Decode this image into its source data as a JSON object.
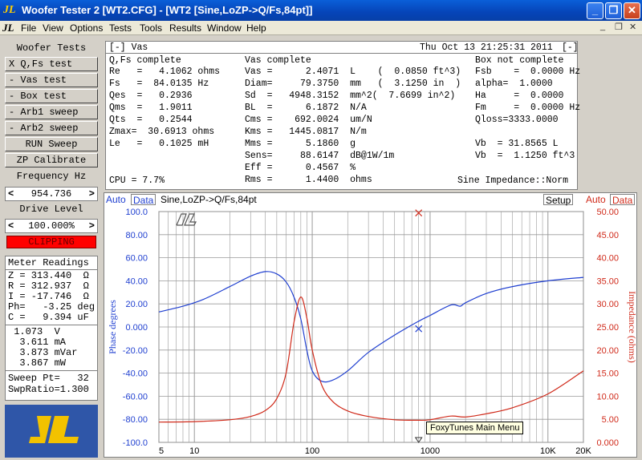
{
  "window": {
    "title": "Woofer Tester 2 [WT2.CFG] - [WT2 [Sine,LoZP->Q/Fs,84pt]]",
    "logo": "JL"
  },
  "menu": [
    "File",
    "View",
    "Options",
    "Tests",
    "Tools",
    "Results",
    "Window",
    "Help"
  ],
  "left": {
    "header": "Woofer Tests",
    "buttons": [
      "X Q,Fs test",
      "- Vas test",
      "- Box test",
      "- Arb1 sweep",
      "- Arb2 sweep",
      "RUN Sweep",
      "ZP Calibrate"
    ],
    "freq_label": "Frequency Hz",
    "freq_value": "954.736",
    "drive_label": "Drive Level",
    "drive_value": "100.000%",
    "clipping": "CLIPPING",
    "meter_title": "Meter Readings",
    "meter": [
      "Z = 313.440  Ω",
      "R = 312.937  Ω",
      "I = -17.746  Ω",
      "Ph=   -3.25 deg",
      "C =   9.394 uF"
    ],
    "meter2": [
      " 1.073  V",
      "  3.611 mA",
      "  3.873 mVar",
      "  3.867 mW"
    ],
    "meter3": [
      "Sweep Pt=   32",
      "SwpRatio=1.300"
    ]
  },
  "vas": {
    "title": "[-] Vas",
    "datetime": "Thu Oct 13 21:25:31 2011",
    "close": "[-]",
    "col1_head": "Q,Fs complete",
    "col2_head": "Vas complete",
    "col3_head": "Box not complete",
    "col1": [
      "Re   =   4.1062 ohms",
      "Fs   =  84.0135 Hz",
      "Qes  =   0.2936",
      "Qms  =   1.9011",
      "Qts  =   0.2544",
      "Zmax=  30.6913 ohms",
      "Le   =   0.1025 mH"
    ],
    "col2": [
      "Vas =      2.4071  L    (  0.0850 ft^3)",
      "Diam=     79.3750  mm   (  3.1250 in  )",
      "Sd  =   4948.3152  mm^2(  7.6699 in^2)",
      "BL  =      6.1872  N/A",
      "Cms =    692.0024  um/N",
      "Kms =   1445.0817  N/m",
      "Mms =      5.1860  g",
      "Sens=     88.6147  dB@1W/1m",
      "Eff =      0.4567  %",
      "Rms =      1.4400  ohms"
    ],
    "col3": [
      "Fsb    =  0.0000 Hz",
      "alpha=  1.0000",
      "Ha     =  0.0000",
      "Fm     =  0.0000 Hz",
      "Qloss=3333.0000"
    ],
    "col3b": [
      "Vb  = 31.8565 L",
      "Vb  =  1.1250 ft^3"
    ],
    "cpu": "CPU = 7.7%",
    "impedance_mode": "Sine Impedance::Norm"
  },
  "chart_toolbar": {
    "auto_left": "Auto",
    "data_left": "Data",
    "title": "Sine,LoZP->Q/Fs,84pt",
    "setup": "Setup",
    "auto_right": "Auto",
    "data_right": "Data"
  },
  "tooltip": "FoxyTunes Main Menu",
  "colors": {
    "phase": "#1f3fd0",
    "impedance": "#d02a1a",
    "grid": "#9a9a9a"
  },
  "chart_data": {
    "type": "line",
    "x_scale": "log",
    "xlim": [
      5,
      20000
    ],
    "x_ticks": [
      5,
      10,
      100,
      1000,
      10000,
      20000
    ],
    "x_tick_labels": [
      "5",
      "10",
      "100",
      "1000",
      "10K",
      "20K"
    ],
    "left_axis": {
      "label": "Phase degrees",
      "ylim": [
        -100,
        100
      ],
      "ticks": [
        100,
        80,
        60,
        40,
        20,
        0,
        -20,
        -40,
        -60,
        -80,
        -100
      ],
      "tick_labels": [
        "100.0",
        "80.00",
        "60.00",
        "40.00",
        "20.00",
        "0.000",
        "-20.00",
        "-40.00",
        "-60.00",
        "-80.00",
        "-100.0"
      ]
    },
    "right_axis": {
      "label": "Impedance (ohms)",
      "ylim": [
        0,
        50
      ],
      "ticks": [
        50,
        45,
        40,
        35,
        30,
        25,
        20,
        15,
        10,
        5,
        0
      ],
      "tick_labels": [
        "50.00",
        "45.00",
        "40.00",
        "35.00",
        "30.00",
        "25.00",
        "20.00",
        "15.00",
        "10.00",
        "5.00",
        "0.000"
      ]
    },
    "series": [
      {
        "axis": "left",
        "x": [
          5,
          8,
          12,
          20,
          30,
          40,
          50,
          60,
          70,
          80,
          90,
          100,
          120,
          150,
          200,
          300,
          500,
          800,
          1000,
          1500,
          1800,
          2000,
          3000,
          5000,
          10000,
          20000
        ],
        "y": [
          13,
          18,
          24,
          35,
          44,
          48,
          46,
          39,
          26,
          7,
          -20,
          -38,
          -47,
          -46,
          -38,
          -22,
          -7,
          5,
          10,
          19,
          18,
          21,
          29,
          35,
          40,
          43
        ]
      },
      {
        "axis": "right",
        "x": [
          5,
          10,
          20,
          30,
          40,
          50,
          60,
          70,
          80,
          90,
          100,
          120,
          150,
          200,
          300,
          500,
          800,
          1000,
          1500,
          2000,
          3000,
          5000,
          10000,
          20000
        ],
        "y": [
          4.4,
          4.5,
          4.9,
          5.6,
          6.9,
          9.5,
          15,
          26,
          31.5,
          27,
          20,
          12.5,
          8.8,
          6.8,
          5.6,
          4.9,
          4.8,
          4.9,
          5.7,
          5.5,
          6.2,
          7.5,
          10.5,
          15.5
        ]
      }
    ],
    "markers": [
      {
        "axis": "left",
        "x": 800,
        "y": -1.5
      },
      {
        "axis": "right",
        "x": 800,
        "y": 49.7
      }
    ]
  }
}
